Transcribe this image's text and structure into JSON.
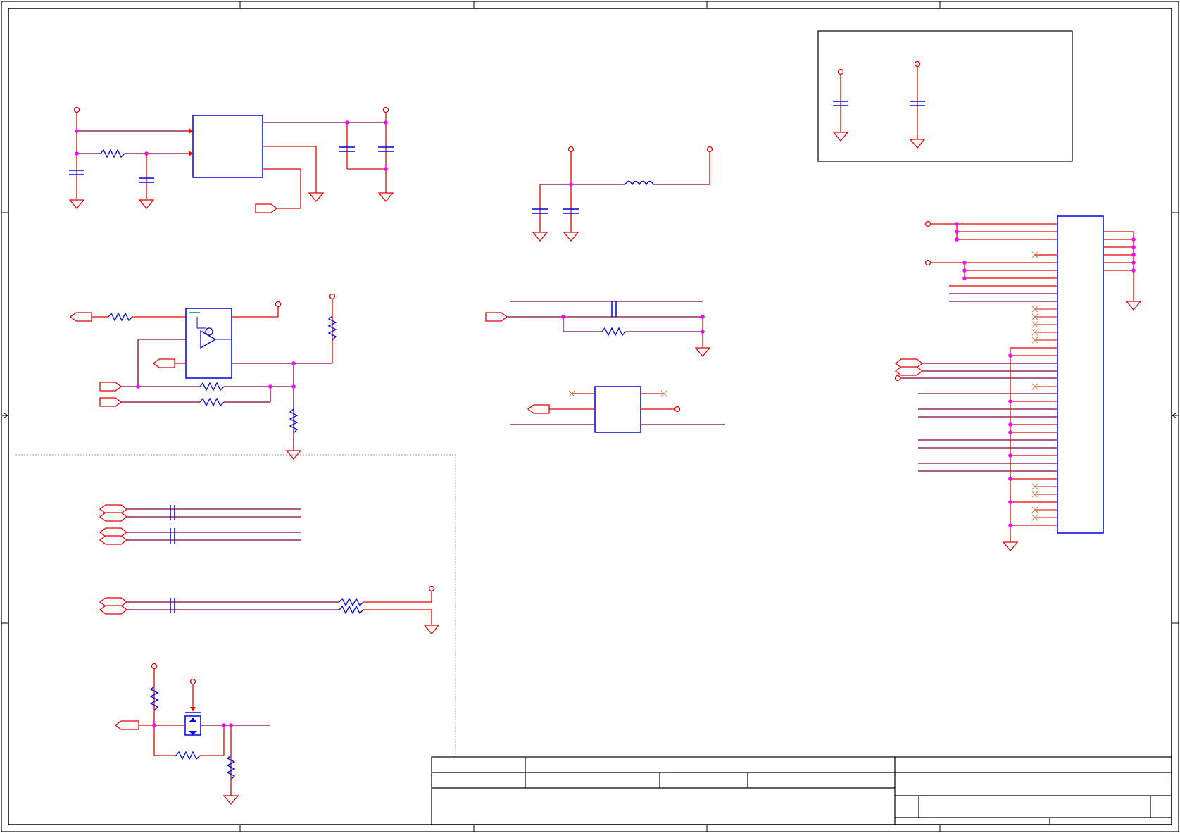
{
  "sheet": {
    "description_visible_text": "",
    "colors": {
      "border": "#000000",
      "wire": "#e60000",
      "net": "#800040",
      "component": "#0000e0",
      "junction": "#ff00ff",
      "no_connect": "#c08040",
      "section_box": "#9090e0",
      "title_block": "#000000"
    },
    "zone_tick_labels": {
      "top": [
        "",
        "",
        "",
        "",
        ""
      ],
      "left": [
        "",
        ""
      ]
    },
    "title_block": {
      "title": "",
      "document_number": "",
      "revision": "",
      "sheet": "",
      "date": ""
    }
  }
}
